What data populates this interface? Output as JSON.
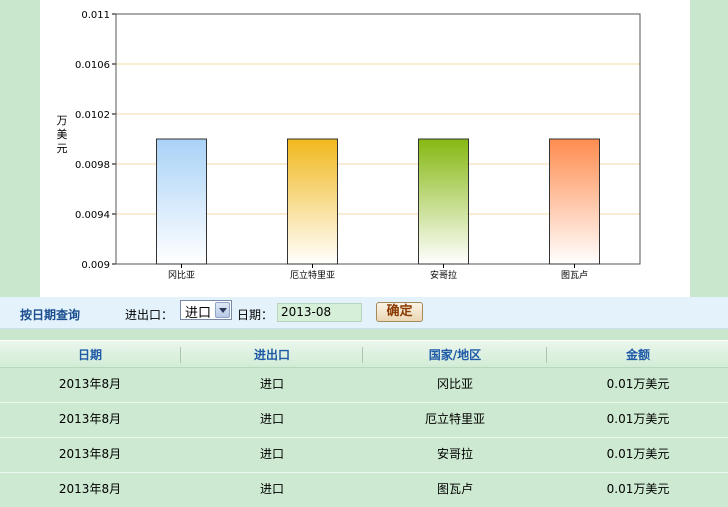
{
  "chart_data": {
    "type": "bar",
    "categories": [
      "冈比亚",
      "厄立特里亚",
      "安哥拉",
      "图瓦卢"
    ],
    "values": [
      0.01,
      0.01,
      0.01,
      0.01
    ],
    "ylabel": "万美元",
    "ylim": [
      0.009,
      0.011
    ],
    "yticks": [
      "0.011",
      "0.0106",
      "0.0102",
      "0.0098",
      "0.0094",
      "0.009"
    ],
    "ytick_values": [
      0.011,
      0.0106,
      0.0102,
      0.0098,
      0.0094,
      0.009
    ],
    "grid": true,
    "colors": [
      "#a9d2f7",
      "#f1b81d",
      "#86b812",
      "#ff8c4f"
    ]
  },
  "query": {
    "title": "按日期查询",
    "type_label": "进出口：",
    "type_value": "进口",
    "date_label": "日期：",
    "date_value": "2013-08",
    "confirm_label": "确定"
  },
  "table": {
    "headers": [
      "日期",
      "进出口",
      "国家/地区",
      "金额"
    ],
    "rows": [
      [
        "2013年8月",
        "进口",
        "冈比亚",
        "0.01万美元"
      ],
      [
        "2013年8月",
        "进口",
        "厄立特里亚",
        "0.01万美元"
      ],
      [
        "2013年8月",
        "进口",
        "安哥拉",
        "0.01万美元"
      ],
      [
        "2013年8月",
        "进口",
        "图瓦卢",
        "0.01万美元"
      ]
    ]
  }
}
